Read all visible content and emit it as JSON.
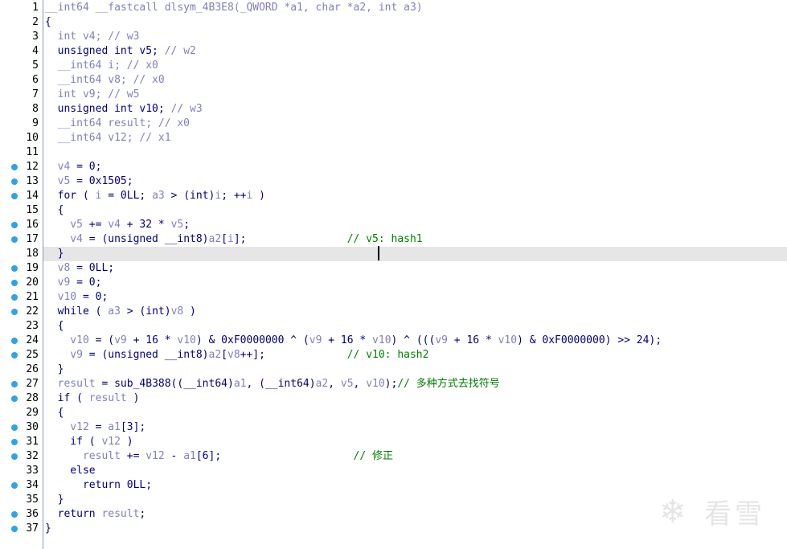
{
  "editor": {
    "current_line": 18,
    "lines": [
      {
        "num": "1",
        "bp": false,
        "tokens": [
          [
            "var",
            "__int64 __fastcall dlsym_4B3E8(_QWORD *a1, char *a2, int a3)"
          ]
        ]
      },
      {
        "num": "2",
        "bp": false,
        "tokens": [
          [
            "kw",
            "{"
          ]
        ]
      },
      {
        "num": "3",
        "bp": false,
        "tokens": [
          [
            "var",
            "  int v4; // w3"
          ]
        ]
      },
      {
        "num": "4",
        "bp": false,
        "tokens": [
          [
            "kw",
            "  unsigned int v5; "
          ],
          [
            "var",
            "// w2"
          ]
        ]
      },
      {
        "num": "5",
        "bp": false,
        "tokens": [
          [
            "var",
            "  __int64 i; // x0"
          ]
        ]
      },
      {
        "num": "6",
        "bp": false,
        "tokens": [
          [
            "var",
            "  __int64 v8; // x0"
          ]
        ]
      },
      {
        "num": "7",
        "bp": false,
        "tokens": [
          [
            "var",
            "  int v9; // w5"
          ]
        ]
      },
      {
        "num": "8",
        "bp": false,
        "tokens": [
          [
            "kw",
            "  unsigned int v10; "
          ],
          [
            "var",
            "// w3"
          ]
        ]
      },
      {
        "num": "9",
        "bp": false,
        "tokens": [
          [
            "var",
            "  __int64 result; // x0"
          ]
        ]
      },
      {
        "num": "10",
        "bp": false,
        "tokens": [
          [
            "var",
            "  __int64 v12; // x1"
          ]
        ]
      },
      {
        "num": "11",
        "bp": false,
        "tokens": [
          [
            "kw",
            ""
          ]
        ]
      },
      {
        "num": "12",
        "bp": true,
        "tokens": [
          [
            "var",
            "  v4"
          ],
          [
            "kw",
            " = 0;"
          ]
        ]
      },
      {
        "num": "13",
        "bp": true,
        "tokens": [
          [
            "var",
            "  v5"
          ],
          [
            "kw",
            " = 0x1505;"
          ]
        ]
      },
      {
        "num": "14",
        "bp": true,
        "tokens": [
          [
            "kw",
            "  for ( "
          ],
          [
            "var",
            "i"
          ],
          [
            "kw",
            " = 0LL; "
          ],
          [
            "var",
            "a3"
          ],
          [
            "kw",
            " > (int)"
          ],
          [
            "var",
            "i"
          ],
          [
            "kw",
            "; ++"
          ],
          [
            "var",
            "i"
          ],
          [
            "kw",
            " )"
          ]
        ]
      },
      {
        "num": "15",
        "bp": false,
        "tokens": [
          [
            "kw",
            "  {"
          ]
        ]
      },
      {
        "num": "16",
        "bp": true,
        "tokens": [
          [
            "var",
            "    v5"
          ],
          [
            "kw",
            " += "
          ],
          [
            "var",
            "v4"
          ],
          [
            "kw",
            " + 32 * "
          ],
          [
            "var",
            "v5"
          ],
          [
            "kw",
            ";"
          ]
        ]
      },
      {
        "num": "17",
        "bp": true,
        "tokens": [
          [
            "var",
            "    v4"
          ],
          [
            "kw",
            " = (unsigned __int8)"
          ],
          [
            "var",
            "a2"
          ],
          [
            "kw",
            "["
          ],
          [
            "var",
            "i"
          ],
          [
            "kw",
            "];                "
          ],
          [
            "cmt",
            "// v5: hash1"
          ]
        ]
      },
      {
        "num": "18",
        "bp": false,
        "tokens": [
          [
            "kw",
            "  }"
          ]
        ]
      },
      {
        "num": "19",
        "bp": true,
        "tokens": [
          [
            "var",
            "  v8"
          ],
          [
            "kw",
            " = 0LL;"
          ]
        ]
      },
      {
        "num": "20",
        "bp": true,
        "tokens": [
          [
            "var",
            "  v9"
          ],
          [
            "kw",
            " = 0;"
          ]
        ]
      },
      {
        "num": "21",
        "bp": true,
        "tokens": [
          [
            "var",
            "  v10"
          ],
          [
            "kw",
            " = 0;"
          ]
        ]
      },
      {
        "num": "22",
        "bp": true,
        "tokens": [
          [
            "kw",
            "  while ( "
          ],
          [
            "var",
            "a3"
          ],
          [
            "kw",
            " > (int)"
          ],
          [
            "var",
            "v8"
          ],
          [
            "kw",
            " )"
          ]
        ]
      },
      {
        "num": "23",
        "bp": false,
        "tokens": [
          [
            "kw",
            "  {"
          ]
        ]
      },
      {
        "num": "24",
        "bp": true,
        "tokens": [
          [
            "var",
            "    v10"
          ],
          [
            "kw",
            " = ("
          ],
          [
            "var",
            "v9"
          ],
          [
            "kw",
            " + 16 * "
          ],
          [
            "var",
            "v10"
          ],
          [
            "kw",
            ") & 0xF0000000 ^ ("
          ],
          [
            "var",
            "v9"
          ],
          [
            "kw",
            " + 16 * "
          ],
          [
            "var",
            "v10"
          ],
          [
            "kw",
            ") ^ ((("
          ],
          [
            "var",
            "v9"
          ],
          [
            "kw",
            " + 16 * "
          ],
          [
            "var",
            "v10"
          ],
          [
            "kw",
            ") & 0xF0000000) >> 24);"
          ]
        ]
      },
      {
        "num": "25",
        "bp": true,
        "tokens": [
          [
            "var",
            "    v9"
          ],
          [
            "kw",
            " = (unsigned __int8)"
          ],
          [
            "var",
            "a2"
          ],
          [
            "kw",
            "["
          ],
          [
            "var",
            "v8"
          ],
          [
            "kw",
            "++];             "
          ],
          [
            "cmt",
            "// v10: hash2"
          ]
        ]
      },
      {
        "num": "26",
        "bp": false,
        "tokens": [
          [
            "kw",
            "  }"
          ]
        ]
      },
      {
        "num": "27",
        "bp": true,
        "tokens": [
          [
            "var",
            "  result"
          ],
          [
            "kw",
            " = sub_4B388((__int64)"
          ],
          [
            "var",
            "a1"
          ],
          [
            "kw",
            ", (__int64)"
          ],
          [
            "var",
            "a2"
          ],
          [
            "kw",
            ", "
          ],
          [
            "var",
            "v5"
          ],
          [
            "kw",
            ", "
          ],
          [
            "var",
            "v10"
          ],
          [
            "kw",
            ");"
          ],
          [
            "cmt",
            "// 多种方式去找符号"
          ]
        ]
      },
      {
        "num": "28",
        "bp": true,
        "tokens": [
          [
            "kw",
            "  if ( "
          ],
          [
            "var",
            "result"
          ],
          [
            "kw",
            " )"
          ]
        ]
      },
      {
        "num": "29",
        "bp": false,
        "tokens": [
          [
            "kw",
            "  {"
          ]
        ]
      },
      {
        "num": "30",
        "bp": true,
        "tokens": [
          [
            "var",
            "    v12"
          ],
          [
            "kw",
            " = "
          ],
          [
            "var",
            "a1"
          ],
          [
            "kw",
            "[3];"
          ]
        ]
      },
      {
        "num": "31",
        "bp": true,
        "tokens": [
          [
            "kw",
            "    if ( "
          ],
          [
            "var",
            "v12"
          ],
          [
            "kw",
            " )"
          ]
        ]
      },
      {
        "num": "32",
        "bp": true,
        "tokens": [
          [
            "var",
            "      result"
          ],
          [
            "kw",
            " += "
          ],
          [
            "var",
            "v12"
          ],
          [
            "kw",
            " - "
          ],
          [
            "var",
            "a1"
          ],
          [
            "kw",
            "[6];                     "
          ],
          [
            "cmt",
            "// 修正"
          ]
        ]
      },
      {
        "num": "33",
        "bp": false,
        "tokens": [
          [
            "kw",
            "    else"
          ]
        ]
      },
      {
        "num": "34",
        "bp": true,
        "tokens": [
          [
            "kw",
            "      return 0LL;"
          ]
        ]
      },
      {
        "num": "35",
        "bp": false,
        "tokens": [
          [
            "kw",
            "  }"
          ]
        ]
      },
      {
        "num": "36",
        "bp": true,
        "tokens": [
          [
            "kw",
            "  return "
          ],
          [
            "var",
            "result"
          ],
          [
            "kw",
            ";"
          ]
        ]
      },
      {
        "num": "37",
        "bp": true,
        "tokens": [
          [
            "kw",
            "}"
          ]
        ]
      }
    ]
  },
  "watermark": {
    "text": "看雪",
    "icon": "snowflake-icon"
  },
  "colors": {
    "keyword": "#000080",
    "variable": "#8080c0",
    "comment": "#008000",
    "breakpoint": "#2fa3e6",
    "current_line_bg": "#e6e6e6"
  }
}
